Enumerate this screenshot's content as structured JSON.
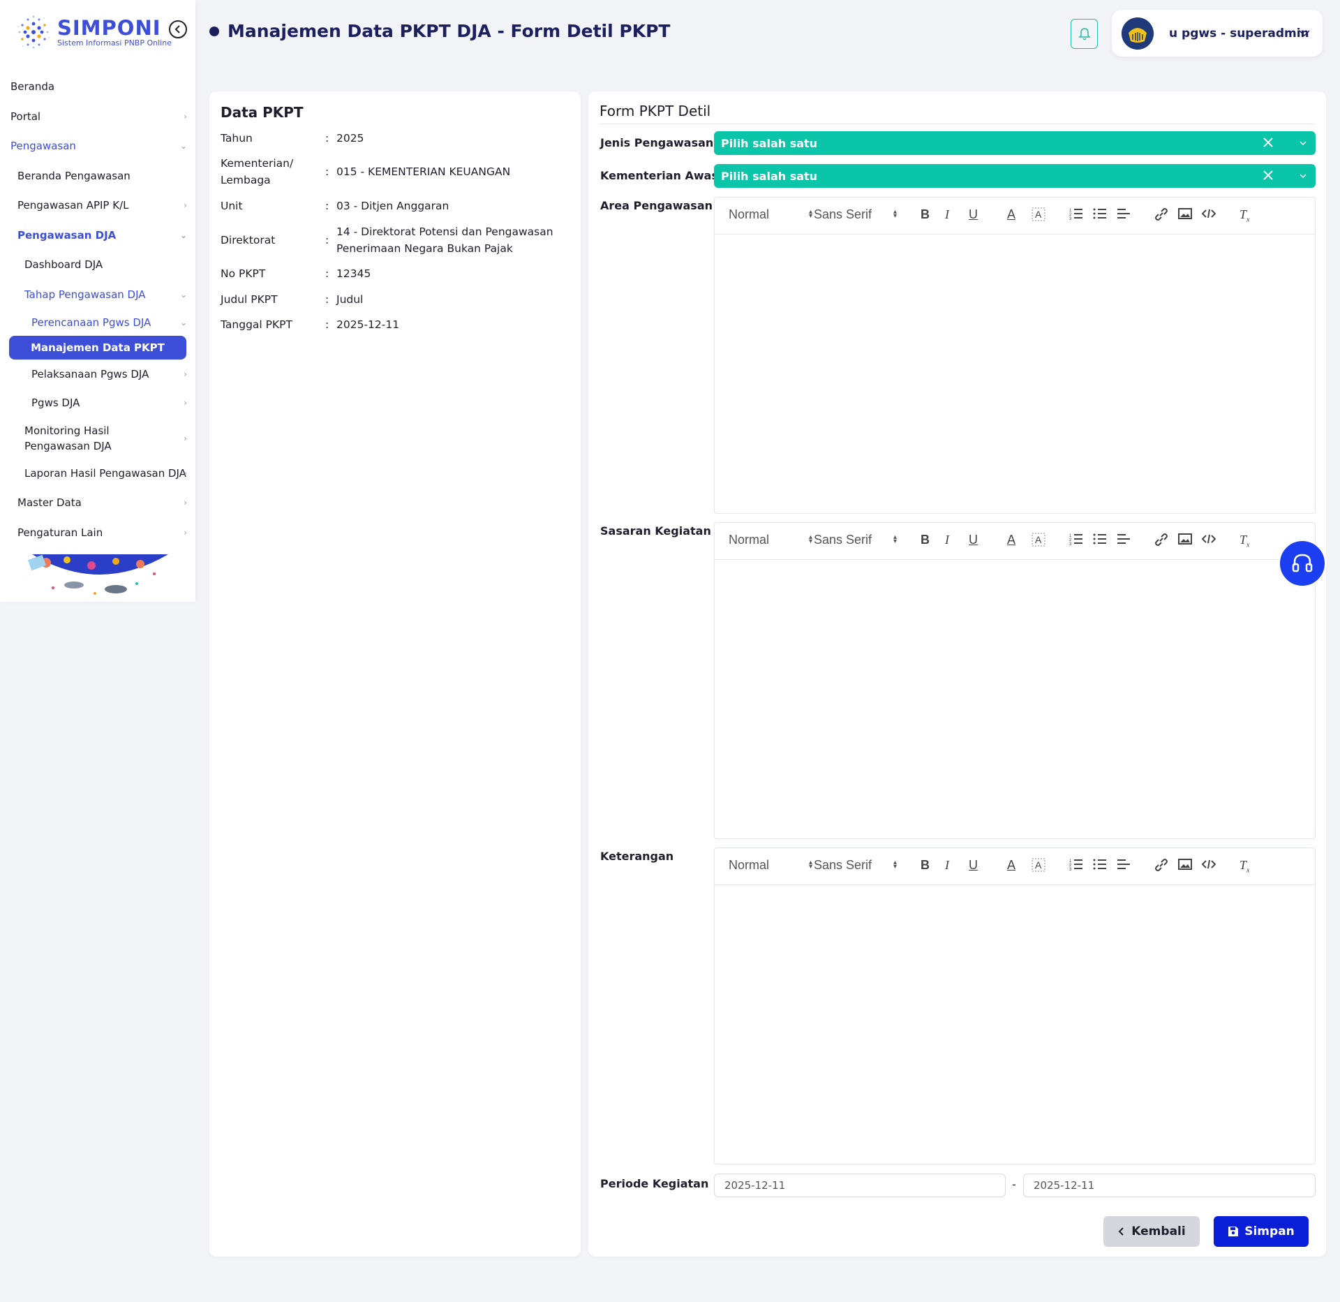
{
  "app": {
    "logo_title": "SIMPONI",
    "logo_subtitle": "Sistem Informasi PNBP Online"
  },
  "header": {
    "title": "Manajemen Data PKPT DJA - Form Detil PKPT",
    "user": "u pgws - superadmin"
  },
  "sidebar": {
    "items": [
      {
        "label": "Beranda"
      },
      {
        "label": "Portal"
      },
      {
        "label": "Pengawasan"
      },
      {
        "label": "Beranda Pengawasan"
      },
      {
        "label": "Pengawasan APIP K/L"
      },
      {
        "label": "Pengawasan DJA"
      },
      {
        "label": "Dashboard DJA"
      },
      {
        "label": "Tahap Pengawasan DJA"
      },
      {
        "label": "Perencanaan Pgws DJA"
      },
      {
        "label": "Manajemen Data PKPT"
      },
      {
        "label": "Pelaksanaan Pgws DJA"
      },
      {
        "label": "Pgws DJA"
      },
      {
        "label": "Monitoring Hasil Pengawasan DJA"
      },
      {
        "label": "Laporan Hasil Pengawasan DJA"
      },
      {
        "label": "Master Data"
      },
      {
        "label": "Pengaturan Lain"
      }
    ]
  },
  "data_pkpt": {
    "title": "Data PKPT",
    "rows": [
      {
        "key": "Tahun",
        "sep": ":",
        "value": "2025"
      },
      {
        "key": "Kementerian/ Lembaga",
        "sep": ":",
        "value": "015 - KEMENTERIAN KEUANGAN"
      },
      {
        "key": "Unit",
        "sep": ":",
        "value": "03 - Ditjen Anggaran"
      },
      {
        "key": "Direktorat",
        "sep": ":",
        "value": "14 - Direktorat Potensi dan Pengawasan Penerimaan Negara Bukan Pajak"
      },
      {
        "key": "No PKPT",
        "sep": ":",
        "value": "12345"
      },
      {
        "key": "Judul PKPT",
        "sep": ":",
        "value": "Judul"
      },
      {
        "key": "Tanggal PKPT",
        "sep": ":",
        "value": "2025-12-11"
      }
    ]
  },
  "form": {
    "title": "Form PKPT Detil",
    "jenis_label": "Jenis Pengawasan",
    "jenis_value": "Pilih salah satu",
    "kementerian_label": "Kementerian Awas",
    "kementerian_value": "Pilih salah satu",
    "area_label": "Area Pengawasan",
    "sasaran_label": "Sasaran Kegiatan",
    "keterangan_label": "Keterangan",
    "periode_label": "Periode Kegiatan",
    "periode_start": "2025-12-11",
    "periode_sep": "-",
    "periode_end": "2025-12-11",
    "toolbar": {
      "format": "Normal",
      "font": "Sans Serif"
    },
    "back_label": "Kembali",
    "save_label": "Simpan"
  },
  "colors": {
    "primary": "#3d4ed8",
    "teal": "#0bc5a9",
    "save": "#0a1ed8",
    "title": "#1b1f5e"
  }
}
